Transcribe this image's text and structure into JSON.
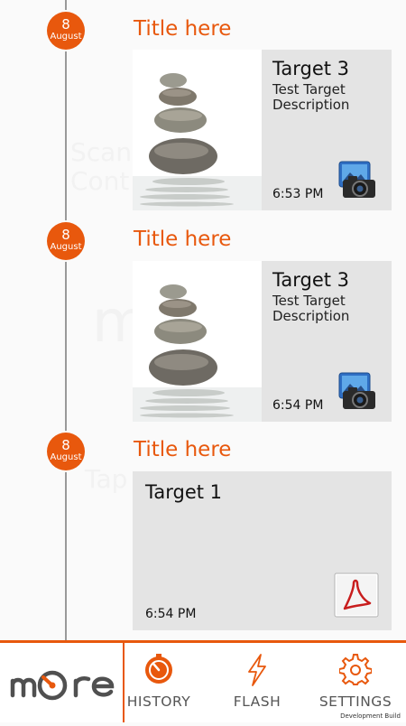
{
  "background_text": [
    "Scan",
    "Cont",
    "m",
    "Tap"
  ],
  "timeline": [
    {
      "date": {
        "day": "8",
        "month": "August"
      },
      "title": "Title here",
      "card": {
        "type": "image",
        "name": "Target 3",
        "description": "Test Target Description",
        "time": "6:53 PM",
        "icon": "camera-icon"
      }
    },
    {
      "date": {
        "day": "8",
        "month": "August"
      },
      "title": "Title here",
      "card": {
        "type": "image",
        "name": "Target 3",
        "description": "Test Target Description",
        "time": "6:54 PM",
        "icon": "camera-icon"
      }
    },
    {
      "date": {
        "day": "8",
        "month": "August"
      },
      "title": "Title here",
      "card": {
        "type": "text",
        "name": "Target 1",
        "time": "6:54 PM",
        "icon": "pdf-icon"
      }
    }
  ],
  "bottom_nav": {
    "logo": "more",
    "items": [
      {
        "label": "HISTORY",
        "icon": "history-icon",
        "active": true
      },
      {
        "label": "FLASH",
        "icon": "flash-icon",
        "active": false
      },
      {
        "label": "SETTINGS",
        "icon": "settings-icon",
        "active": false
      }
    ]
  },
  "build_note": "Development Build",
  "colors": {
    "accent": "#e8580d",
    "card": "#e4e4e4",
    "timeline": "#9a9a9a",
    "background": "#fafafa"
  }
}
